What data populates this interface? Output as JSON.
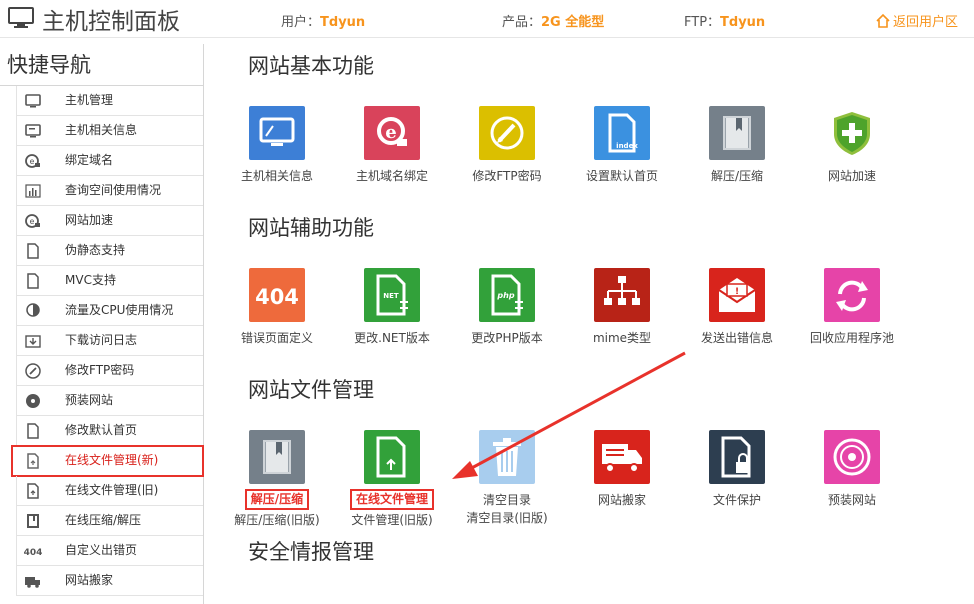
{
  "header": {
    "title": "主机控制面板",
    "user_label": "用户：",
    "user_value": "Tdyun",
    "product_label": "产品：",
    "product_value": "2G 全能型",
    "ftp_label": "FTP：",
    "ftp_value": "Tdyun",
    "back_label": "返回用户区"
  },
  "sidebar": {
    "title": "快捷导航",
    "items": [
      {
        "label": "主机管理",
        "icon": "monitor-icon"
      },
      {
        "label": "主机相关信息",
        "icon": "monitor-info-icon"
      },
      {
        "label": "绑定域名",
        "icon": "domain-icon"
      },
      {
        "label": "查询空间使用情况",
        "icon": "chart-icon"
      },
      {
        "label": "网站加速",
        "icon": "domain-icon"
      },
      {
        "label": "伪静态支持",
        "icon": "file-icon"
      },
      {
        "label": "MVC支持",
        "icon": "file-icon"
      },
      {
        "label": "流量及CPU使用情况",
        "icon": "cpu-icon"
      },
      {
        "label": "下载访问日志",
        "icon": "download-icon"
      },
      {
        "label": "修改FTP密码",
        "icon": "edit-icon"
      },
      {
        "label": "预装网站",
        "icon": "disc-icon"
      },
      {
        "label": "修改默认首页",
        "icon": "file-icon"
      },
      {
        "label": "在线文件管理(新)",
        "icon": "file-upload-icon"
      },
      {
        "label": "在线文件管理(旧)",
        "icon": "file-upload-icon"
      },
      {
        "label": "在线压缩/解压",
        "icon": "book-icon"
      },
      {
        "label": "自定义出错页",
        "icon": "404-icon"
      },
      {
        "label": "网站搬家",
        "icon": "truck-icon"
      }
    ]
  },
  "sections": [
    {
      "title": "网站基本功能",
      "tiles": [
        {
          "label": "主机相关信息",
          "color": "#3d7fd6",
          "icon": "monitor-icon"
        },
        {
          "label": "主机域名绑定",
          "color": "#d9435b",
          "icon": "domain-icon"
        },
        {
          "label": "修改FTP密码",
          "color": "#dbbf00",
          "icon": "edit-icon"
        },
        {
          "label": "设置默认首页",
          "color": "#3b91e0",
          "icon": "index-file-icon",
          "badge": "index"
        },
        {
          "label": "解压/压缩",
          "color": "#75808a",
          "icon": "book-icon"
        },
        {
          "label": "网站加速",
          "color": "#ffffff",
          "icon": "shield-plus-icon"
        }
      ]
    },
    {
      "title": "网站辅助功能",
      "tiles": [
        {
          "label": "错误页面定义",
          "color": "#ee6a3c",
          "icon": "404-icon",
          "badge": "404"
        },
        {
          "label": "更改.NET版本",
          "color": "#32a13a",
          "icon": "net-file-icon",
          "badge": "NET"
        },
        {
          "label": "更改PHP版本",
          "color": "#32a13a",
          "icon": "php-file-icon",
          "badge": "php"
        },
        {
          "label": "mime类型",
          "color": "#b82317",
          "icon": "sitemap-icon"
        },
        {
          "label": "发送出错信息",
          "color": "#d8241c",
          "icon": "mail-icon"
        },
        {
          "label": "回收应用程序池",
          "color": "#e644a8",
          "icon": "refresh-icon"
        }
      ]
    },
    {
      "title": "网站文件管理",
      "tiles": [
        {
          "label": "解压/压缩",
          "label2": "解压/压缩(旧版)",
          "color": "#75808a",
          "icon": "book-icon",
          "highlight": true
        },
        {
          "label": "在线文件管理",
          "label2": "文件管理(旧版)",
          "color": "#32a13a",
          "icon": "file-upload-icon",
          "highlight": true
        },
        {
          "label": "清空目录",
          "label2": "清空目录(旧版)",
          "color": "#a8cdee",
          "icon": "trash-icon"
        },
        {
          "label": "网站搬家",
          "color": "#d8241c",
          "icon": "truck-icon"
        },
        {
          "label": "文件保护",
          "color": "#2d3e50",
          "icon": "lock-file-icon"
        },
        {
          "label": "预装网站",
          "color": "#e644a8",
          "icon": "disc-icon"
        }
      ]
    },
    {
      "title": "安全情报管理",
      "tiles": []
    }
  ],
  "colors": {
    "accent": "#f7941d",
    "highlight": "#e8322b"
  }
}
